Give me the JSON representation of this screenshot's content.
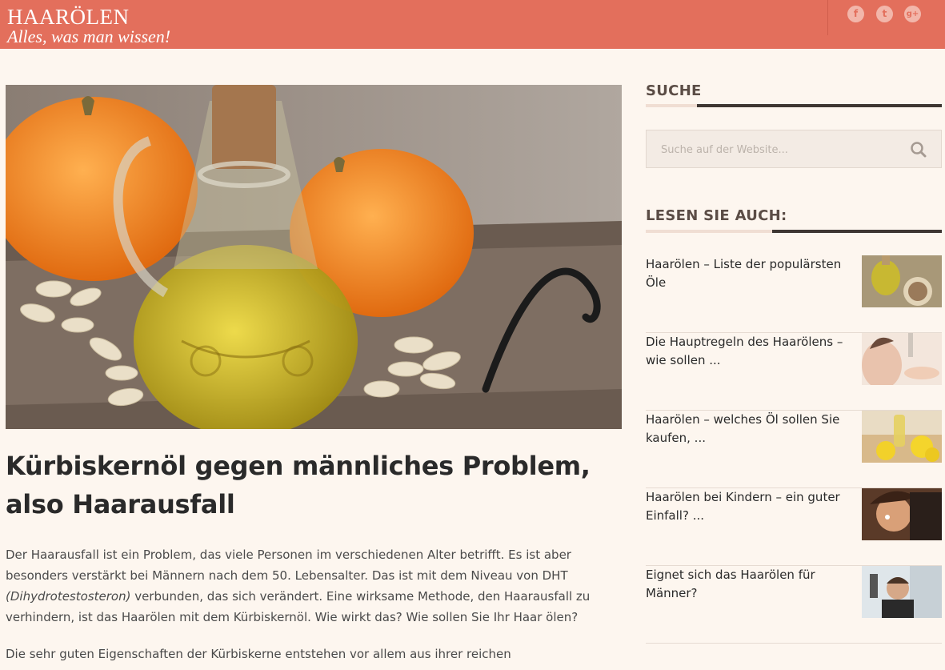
{
  "header": {
    "title": "HAARÖLEN",
    "tagline": "Alles, was man wissen!",
    "social": [
      {
        "icon": "facebook-icon",
        "glyph": "f"
      },
      {
        "icon": "twitter-icon",
        "glyph": "t"
      },
      {
        "icon": "google-plus-icon",
        "glyph": "g+"
      }
    ]
  },
  "article": {
    "hero_image": "pumpkin-seed-oil-bottle-image",
    "title": "Kürbiskernöl gegen männliches Problem, also Haarausfall",
    "paragraph1_a": "Der Haarausfall ist ein Problem, das viele Personen im verschiedenen Alter betrifft. Es ist aber besonders verstärkt bei Männern nach dem 50. Lebensalter. Das ist mit dem Niveau von DHT ",
    "paragraph1_em": "(Dihydrotestosteron)",
    "paragraph1_b": " verbunden, das sich verändert. Eine wirksame Methode, den Haarausfall zu verhindern, ist das Haarölen mit dem Kürbiskernöl. Wie wirkt das? Wie sollen Sie Ihr Haar ölen?",
    "paragraph2": "Die sehr guten Eigenschaften der Kürbiskerne entstehen vor allem aus ihrer reichen"
  },
  "sidebar": {
    "search": {
      "title": "SUCHE",
      "placeholder": "Suche auf der Website...",
      "icon": "search-icon"
    },
    "related": {
      "title": "LESEN SIE AUCH:",
      "items": [
        {
          "label": "Haarölen – Liste der populärsten Öle",
          "thumb": "oil-and-seeds-thumbnail"
        },
        {
          "label": "Die Hauptregeln des Haarölens – wie sollen ...",
          "thumb": "oil-dropper-hand-thumbnail"
        },
        {
          "label": "Haarölen – welches Öl sollen Sie kaufen, ...",
          "thumb": "lemon-oil-thumbnail"
        },
        {
          "label": "Haarölen bei Kindern – ein guter Einfall? ...",
          "thumb": "child-hair-thumbnail"
        },
        {
          "label": "Eignet sich das Haarölen für Männer?",
          "thumb": "barber-man-thumbnail"
        }
      ]
    }
  },
  "colors": {
    "header_bg": "#e36f5c",
    "page_bg": "#fdf6ef",
    "accent_dark": "#3e3632"
  }
}
